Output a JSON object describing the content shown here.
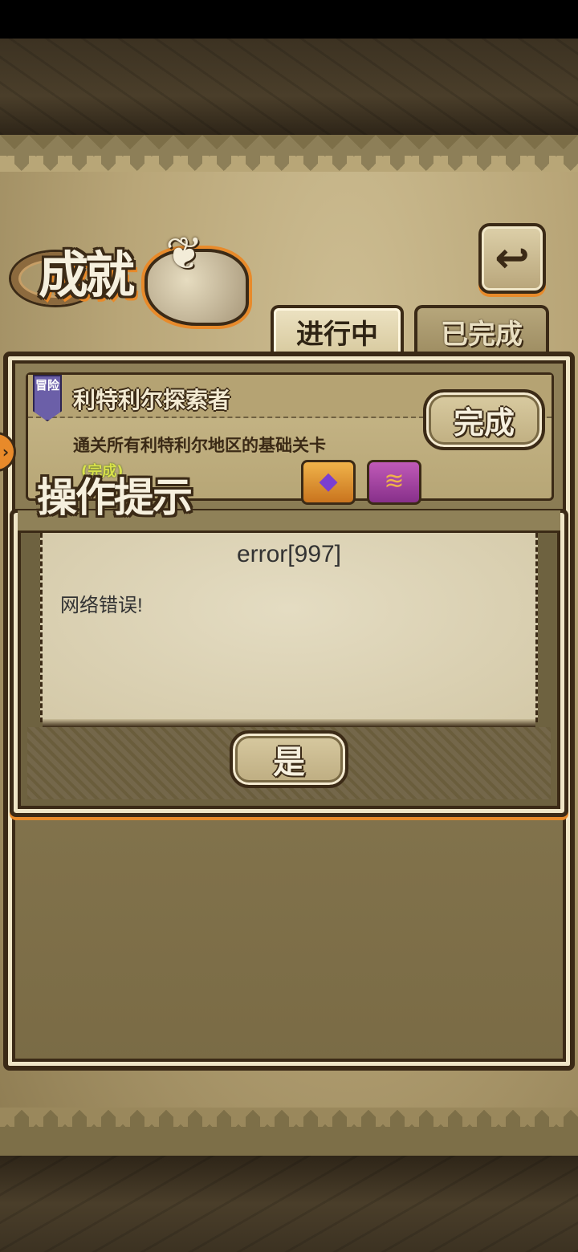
{
  "screen": {
    "title": "成就",
    "back_icon": "↩"
  },
  "tabs": [
    {
      "label": "进行中",
      "active": true
    },
    {
      "label": "已完成",
      "active": false
    }
  ],
  "achievement": {
    "badge": "冒险",
    "title": "利特利尔探索者",
    "description": "通关所有利特利尔地区的基础关卡",
    "status": "(完成)",
    "button_label": "完成",
    "rewards": [
      {
        "icon": "crystal-icon",
        "glyph": "◆"
      },
      {
        "icon": "bread-icon",
        "glyph": "≋"
      }
    ]
  },
  "dialog": {
    "title": "操作提示",
    "heading": "error[997]",
    "message": "网络错误!",
    "confirm_label": "是"
  },
  "colors": {
    "outline": "#3b2a16",
    "accent_orange": "#e88a2a",
    "parchment": "#c9b98a",
    "tab_badge_purple": "#6b5fa8",
    "status_green": "#d9e24a"
  }
}
